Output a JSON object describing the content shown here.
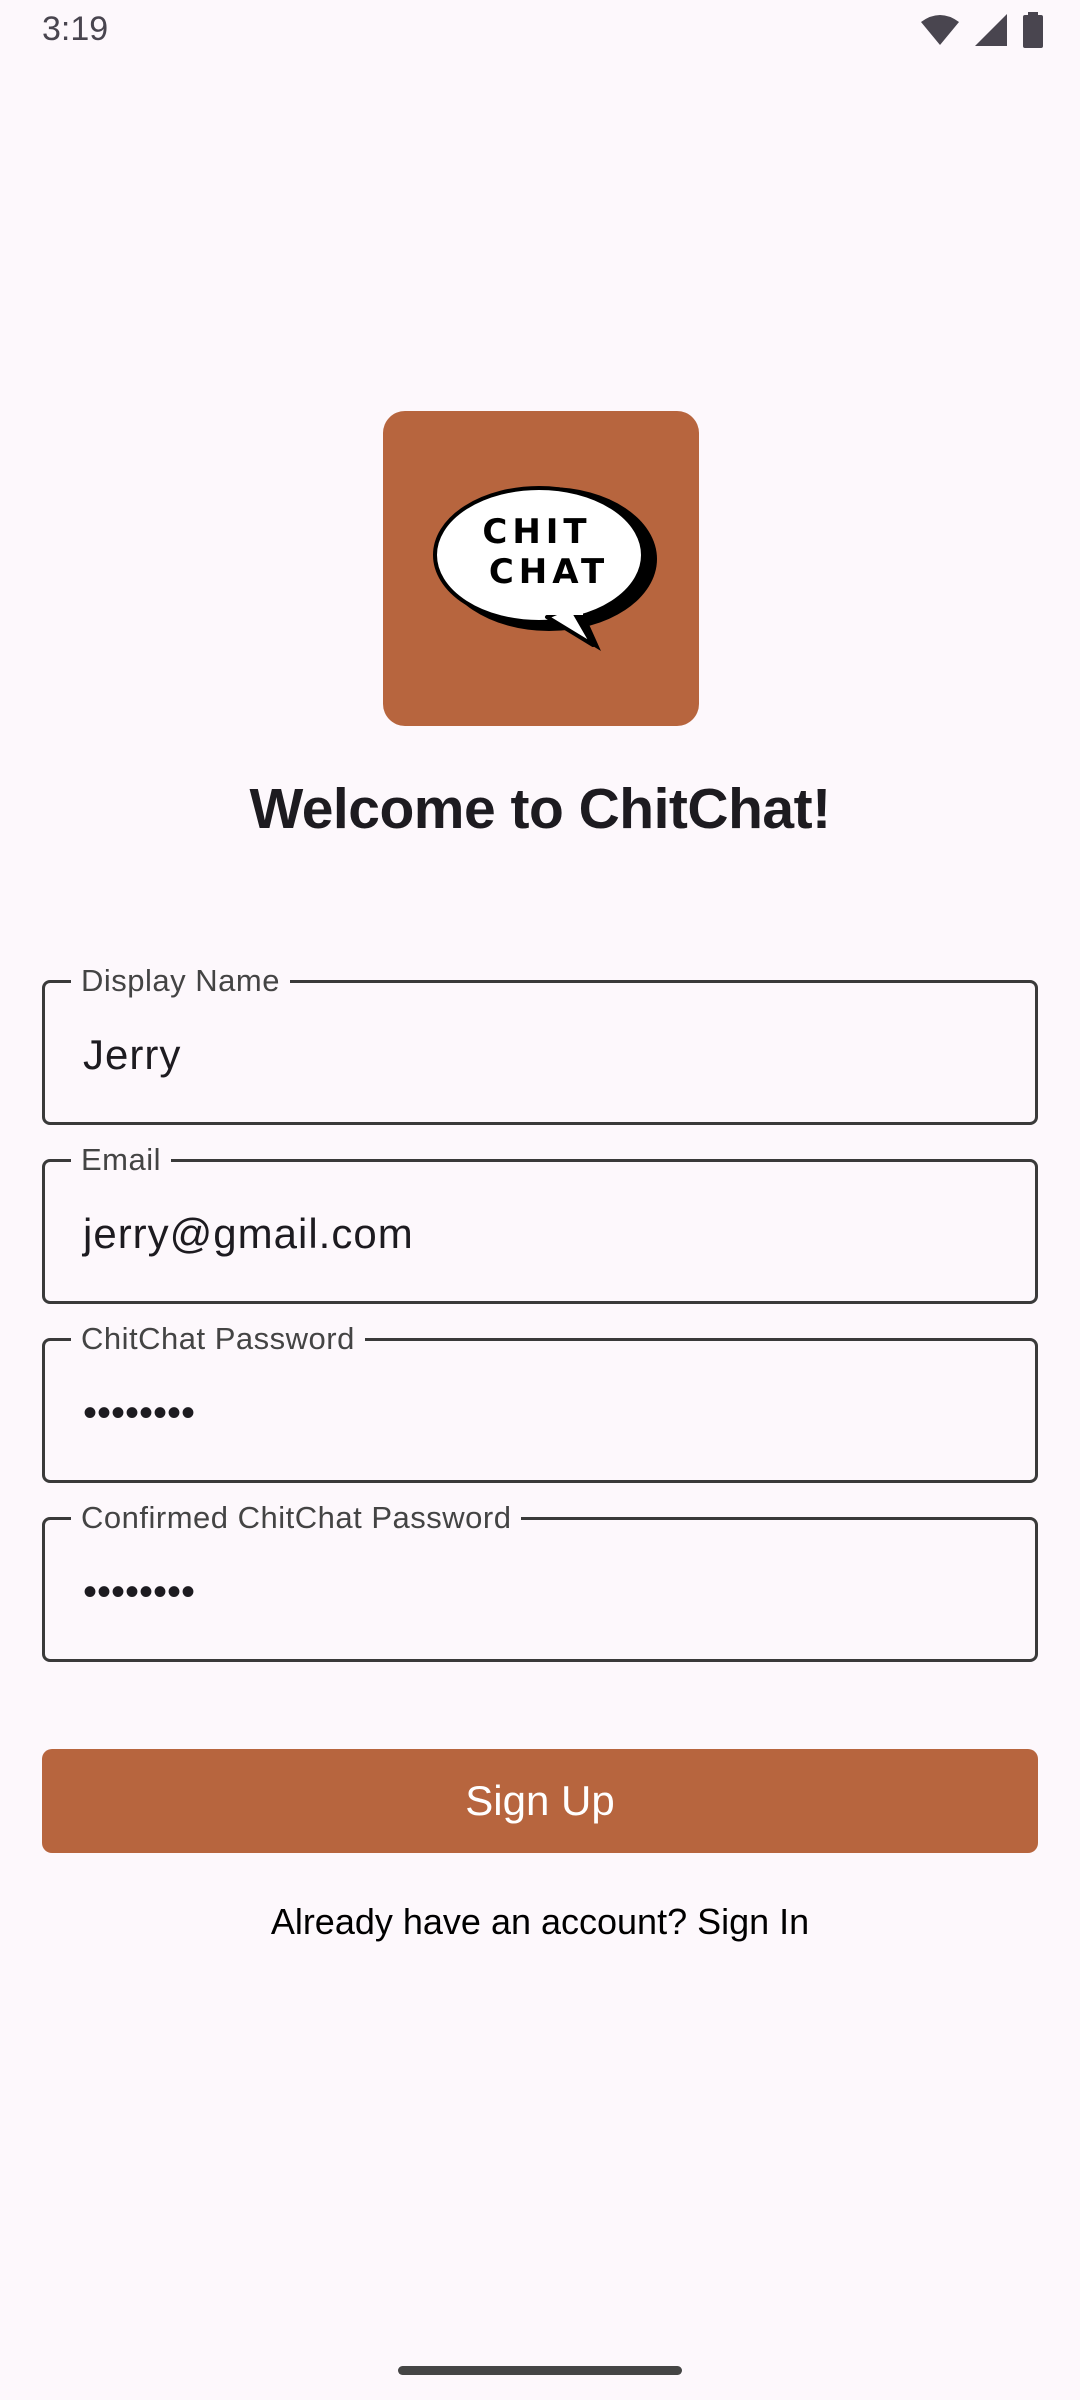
{
  "status_bar": {
    "time": "3:19",
    "icons": [
      "wifi-icon",
      "cellular-signal-icon",
      "battery-icon"
    ]
  },
  "logo": {
    "text_line1": "CHIT",
    "text_line2": "CHAT",
    "background_color": "#b7653e"
  },
  "welcome": {
    "title": "Welcome to ChitChat!"
  },
  "form": {
    "display_name": {
      "label": "Display Name",
      "value": "Jerry"
    },
    "email": {
      "label": "Email",
      "value": "jerry@gmail.com"
    },
    "password": {
      "label": "ChitChat Password",
      "value": "••••••••"
    },
    "confirm_password": {
      "label": "Confirmed ChitChat Password",
      "value": "••••••••"
    }
  },
  "actions": {
    "sign_up_label": "Sign Up",
    "sign_in_prompt": "Already have an account? Sign In"
  },
  "colors": {
    "accent": "#b7653e",
    "background": "#fdf8fc",
    "text": "#1d1b20"
  }
}
